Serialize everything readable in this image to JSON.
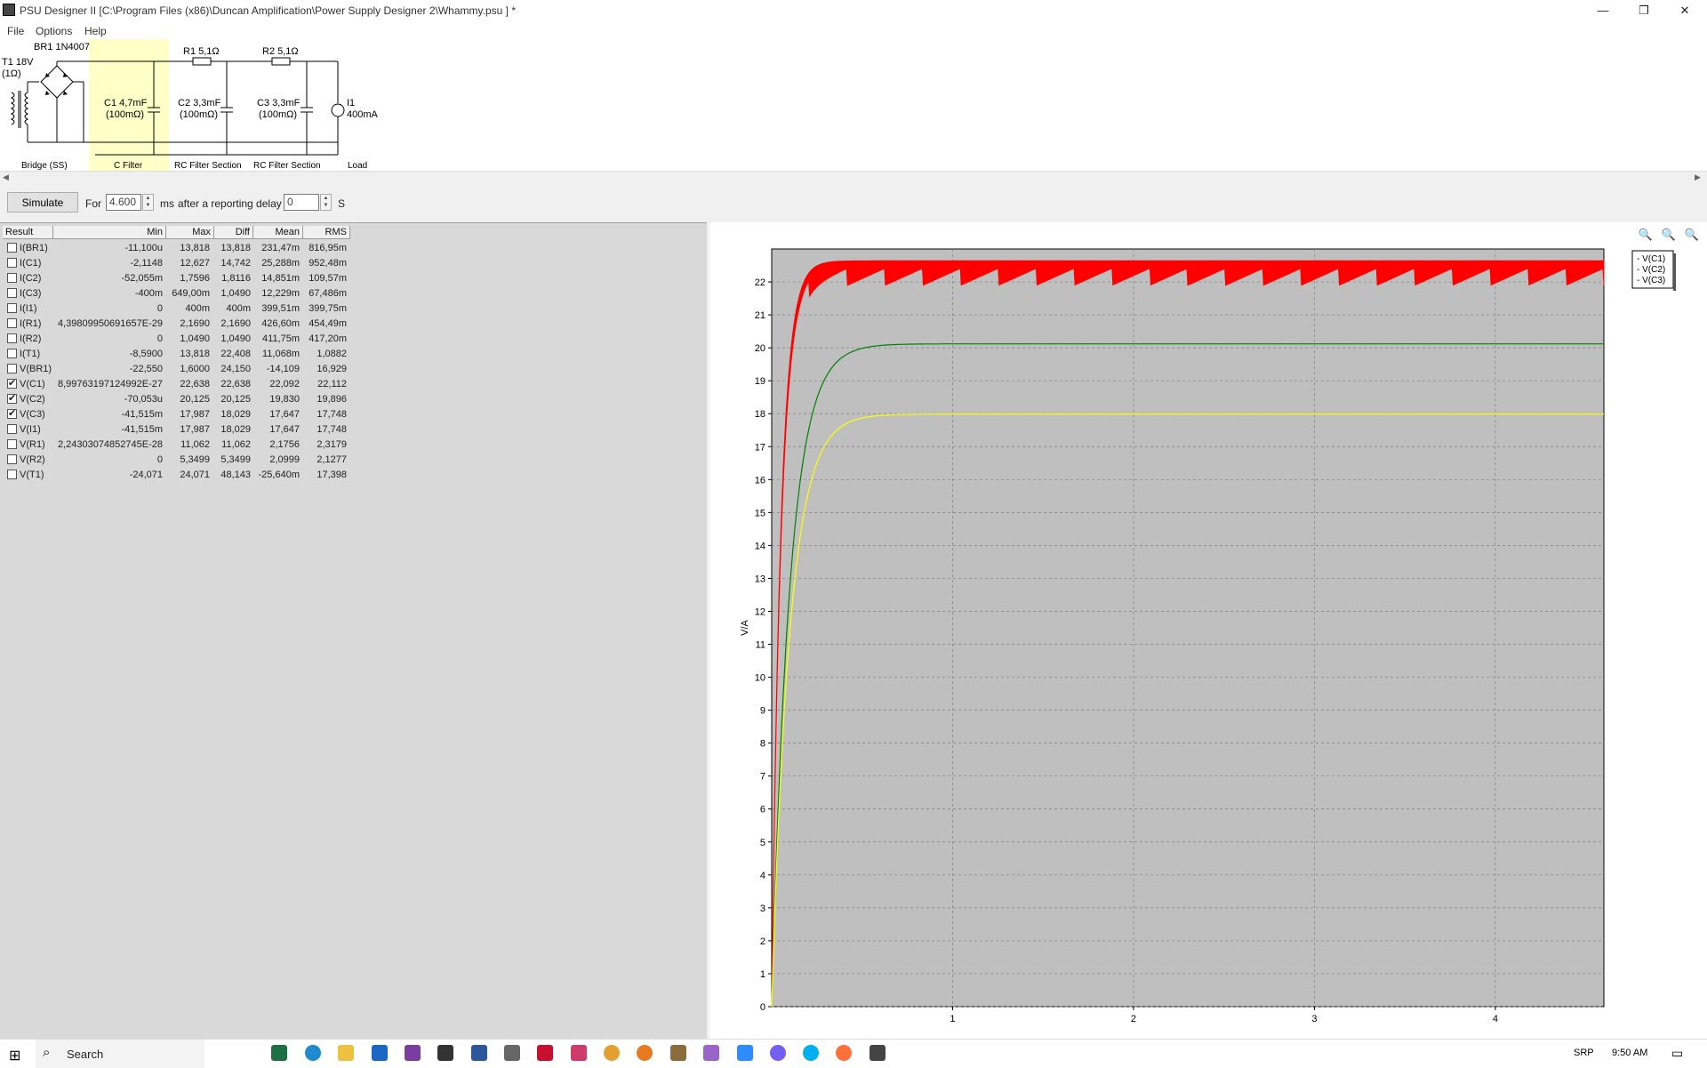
{
  "window": {
    "title": "PSU Designer II  [C:\\Program Files (x86)\\Duncan Amplification\\Power Supply Designer 2\\Whammy.psu ] *",
    "minimize": "—",
    "restore": "❐",
    "close": "✕"
  },
  "menu": [
    "File",
    "Options",
    "Help"
  ],
  "schematic": {
    "transformer": {
      "label": "T1 18V",
      "sub": "(1Ω)"
    },
    "bridge": {
      "label": "BR1 1N4007",
      "section": "Bridge (SS)"
    },
    "c1": {
      "label": "C1 4,7mF",
      "sub": "(100mΩ)",
      "section": "C Filter"
    },
    "r1": "R1 5,1Ω",
    "c2": {
      "label": "C2 3,3mF",
      "sub": "(100mΩ)",
      "section": "RC Filter Section"
    },
    "r2": "R2 5,1Ω",
    "c3": {
      "label": "C3 3,3mF",
      "sub": "(100mΩ)",
      "section": "RC Filter Section"
    },
    "load": {
      "label": "I1",
      "sub": "400mA",
      "section": "Load"
    }
  },
  "sim": {
    "button": "Simulate",
    "for_label": "For",
    "duration": "4.600",
    "unit_ms": "ms",
    "delay_label": "after a reporting delay of",
    "delay": "0",
    "unit_s": "S"
  },
  "results": {
    "headers": [
      "Result",
      "Min",
      "Max",
      "Diff",
      "Mean",
      "RMS"
    ],
    "rows": [
      {
        "checked": false,
        "name": "I(BR1)",
        "min": "-11,100u",
        "max": "13,818",
        "diff": "13,818",
        "mean": "231,47m",
        "rms": "816,95m"
      },
      {
        "checked": false,
        "name": "I(C1)",
        "min": "-2,1148",
        "max": "12,627",
        "diff": "14,742",
        "mean": "25,288m",
        "rms": "952,48m"
      },
      {
        "checked": false,
        "name": "I(C2)",
        "min": "-52,055m",
        "max": "1,7596",
        "diff": "1,8116",
        "mean": "14,851m",
        "rms": "109,57m"
      },
      {
        "checked": false,
        "name": "I(C3)",
        "min": "-400m",
        "max": "649,00m",
        "diff": "1,0490",
        "mean": "12,229m",
        "rms": "67,486m"
      },
      {
        "checked": false,
        "name": "I(I1)",
        "min": "0",
        "max": "400m",
        "diff": "400m",
        "mean": "399,51m",
        "rms": "399,75m"
      },
      {
        "checked": false,
        "name": "I(R1)",
        "min": "4,39809950691657E-29",
        "max": "2,1690",
        "diff": "2,1690",
        "mean": "426,60m",
        "rms": "454,49m"
      },
      {
        "checked": false,
        "name": "I(R2)",
        "min": "0",
        "max": "1,0490",
        "diff": "1,0490",
        "mean": "411,75m",
        "rms": "417,20m"
      },
      {
        "checked": false,
        "name": "I(T1)",
        "min": "-8,5900",
        "max": "13,818",
        "diff": "22,408",
        "mean": "11,068m",
        "rms": "1,0882"
      },
      {
        "checked": false,
        "name": "V(BR1)",
        "min": "-22,550",
        "max": "1,6000",
        "diff": "24,150",
        "mean": "-14,109",
        "rms": "16,929"
      },
      {
        "checked": true,
        "name": "V(C1)",
        "min": "8,99763197124992E-27",
        "max": "22,638",
        "diff": "22,638",
        "mean": "22,092",
        "rms": "22,112"
      },
      {
        "checked": true,
        "name": "V(C2)",
        "min": "-70,053u",
        "max": "20,125",
        "diff": "20,125",
        "mean": "19,830",
        "rms": "19,896"
      },
      {
        "checked": true,
        "name": "V(C3)",
        "min": "-41,515m",
        "max": "17,987",
        "diff": "18,029",
        "mean": "17,647",
        "rms": "17,748"
      },
      {
        "checked": false,
        "name": "V(I1)",
        "min": "-41,515m",
        "max": "17,987",
        "diff": "18,029",
        "mean": "17,647",
        "rms": "17,748"
      },
      {
        "checked": false,
        "name": "V(R1)",
        "min": "2,24303074852745E-28",
        "max": "11,062",
        "diff": "11,062",
        "mean": "2,1756",
        "rms": "2,3179"
      },
      {
        "checked": false,
        "name": "V(R2)",
        "min": "0",
        "max": "5,3499",
        "diff": "5,3499",
        "mean": "2,0999",
        "rms": "2,1277"
      },
      {
        "checked": false,
        "name": "V(T1)",
        "min": "-24,071",
        "max": "24,071",
        "diff": "48,143",
        "mean": "-25,640m",
        "rms": "17,398"
      }
    ]
  },
  "chart_data": {
    "type": "line",
    "ylabel": "V/A",
    "xlabel": "",
    "xlim": [
      0,
      4.6
    ],
    "ylim": [
      0,
      23
    ],
    "xticks": [
      1,
      2,
      3,
      4
    ],
    "yticks": [
      0,
      1,
      2,
      3,
      4,
      5,
      6,
      7,
      8,
      9,
      10,
      11,
      12,
      13,
      14,
      15,
      16,
      17,
      18,
      19,
      20,
      21,
      22
    ],
    "grid": true,
    "legend_position": "right",
    "series": [
      {
        "name": "V(C1)",
        "color": "#ff0000",
        "final": 22.09,
        "ripple_min": 21.9,
        "ripple_max": 22.64,
        "ripple_periods": 22
      },
      {
        "name": "V(C2)",
        "color": "#008000",
        "final": 20.12
      },
      {
        "name": "V(C3)",
        "color": "#ffff00",
        "final": 17.99
      }
    ],
    "zoom_icons": [
      "zoom-in-icon",
      "zoom-out-icon",
      "zoom-reset-icon"
    ]
  },
  "taskbar": {
    "search": "Search",
    "tray_lang": "SRP",
    "time": "9:50 AM"
  }
}
